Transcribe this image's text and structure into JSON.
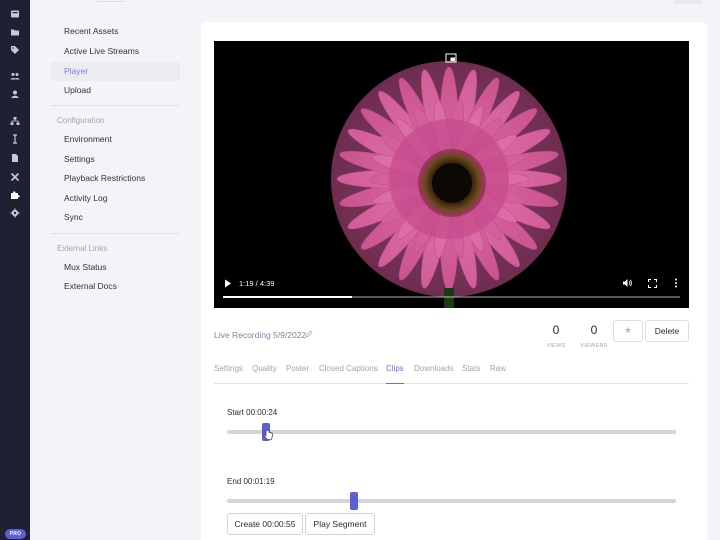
{
  "rail": {
    "icons": [
      "film-icon",
      "folder-icon",
      "tag-icon",
      "users-icon",
      "user-icon",
      "sitemap-icon",
      "text-cursor-icon",
      "file-icon",
      "tools-icon",
      "puzzle-icon",
      "gear-icon"
    ],
    "badge": "PRO"
  },
  "nav": {
    "items_top": [
      {
        "label": "Recent Assets"
      },
      {
        "label": "Active Live Streams"
      },
      {
        "label": "Player",
        "active": true
      },
      {
        "label": "Upload"
      }
    ],
    "configuration_heading": "Configuration",
    "items_config": [
      {
        "label": "Environment"
      },
      {
        "label": "Settings"
      },
      {
        "label": "Playback Restrictions"
      },
      {
        "label": "Activity Log"
      },
      {
        "label": "Sync"
      }
    ],
    "external_heading": "External Links",
    "items_external": [
      {
        "label": "Mux Status"
      },
      {
        "label": "External Docs"
      }
    ]
  },
  "player": {
    "time": "1:19 / 4:39",
    "progress_fraction": 0.283
  },
  "asset": {
    "title": "Live Recording 5/9/2022",
    "views": {
      "value": "0",
      "label": "VIEWS"
    },
    "viewers": {
      "value": "0",
      "label": "VIEWERS"
    },
    "star_label": "*",
    "delete_label": "Delete"
  },
  "tabs": [
    {
      "label": "Settings"
    },
    {
      "label": "Quality"
    },
    {
      "label": "Poster"
    },
    {
      "label": "Closed Captions"
    },
    {
      "label": "Clips",
      "active": true
    },
    {
      "label": "Downloads"
    },
    {
      "label": "Stats"
    },
    {
      "label": "Raw"
    }
  ],
  "clips": {
    "start_label": "Start 00:00:24",
    "start_fraction": 0.086,
    "end_label": "End 00:01:19",
    "end_fraction": 0.283,
    "create_label": "Create 00:00:55",
    "play_label": "Play Segment"
  },
  "colors": {
    "rail": "#1f2033",
    "accent": "#5a5fd8",
    "tab_active": "#6b70dd",
    "nav_active": "#7b7fe0"
  }
}
